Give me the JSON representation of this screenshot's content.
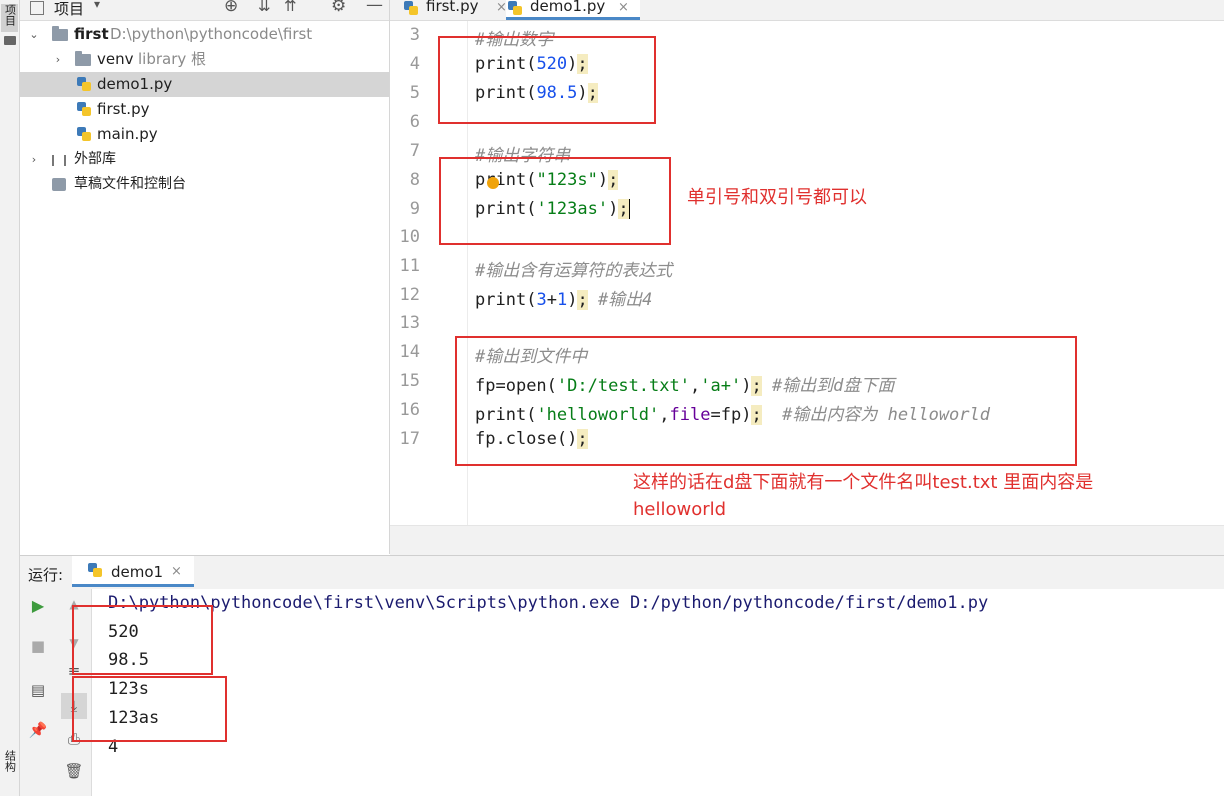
{
  "left_strip": {
    "project_label": "项目",
    "structure_label": "结构"
  },
  "project_panel": {
    "title": "项目",
    "tree": [
      {
        "name": "first",
        "path": "D:\\python\\pythoncode\\first"
      },
      {
        "name": "venv",
        "suffix": "library 根"
      },
      {
        "name": "demo1.py"
      },
      {
        "name": "first.py"
      },
      {
        "name": "main.py"
      },
      {
        "name": "外部库"
      },
      {
        "name": "草稿文件和控制台"
      }
    ]
  },
  "tabs": [
    {
      "label": "first.py",
      "close": "×"
    },
    {
      "label": "demo1.py",
      "close": "×"
    }
  ],
  "editor": {
    "line_numbers": [
      "3",
      "4",
      "5",
      "6",
      "7",
      "8",
      "9",
      "10",
      "11",
      "12",
      "13",
      "14",
      "15",
      "16",
      "17"
    ],
    "lines": {
      "l3": "#输出数字",
      "l4": {
        "fn": "print",
        "open": "(",
        "arg": "520",
        "close": ")",
        "semi": ";"
      },
      "l5": {
        "fn": "print",
        "open": "(",
        "arg": "98.5",
        "close": ")",
        "semi": ";"
      },
      "l7": "#输出字符串",
      "l8": {
        "fn": "print",
        "open": "(",
        "arg": "\"123s\"",
        "close": ")",
        "semi": ";"
      },
      "l9": {
        "fn": "print",
        "open": "(",
        "arg": "'123as'",
        "close": ")",
        "semi": ";"
      },
      "l11": "#输出含有运算符的表达式",
      "l12": {
        "fn": "print",
        "open": "(",
        "a": "3",
        "op": "+",
        "b": "1",
        "close": ")",
        "semi": ";",
        "comment": "#输出4"
      },
      "l14": "#输出到文件中",
      "l15": {
        "var": "fp=",
        "fn": "open",
        "open": "(",
        "s1": "'D:/test.txt'",
        "comma": ",",
        "s2": "'a+'",
        "close": ")",
        "semi": ";",
        "comment": "#输出到d盘下面"
      },
      "l16": {
        "fn": "print",
        "open": "(",
        "s1": "'helloworld'",
        "comma": ",",
        "param": "file",
        "eq": "=fp",
        "close": ")",
        "semi": ";",
        "comment": "#输出内容为 helloworld"
      },
      "l17": {
        "code": "fp.close()",
        "semi": ";"
      }
    }
  },
  "annotations": {
    "quote_note": "单引号和双引号都可以",
    "file_note_1": "这样的话在d盘下面就有一个文件名叫test.txt 里面内容是",
    "file_note_2": "helloworld"
  },
  "run_panel": {
    "label": "运行:",
    "tab": "demo1",
    "tab_close": "×",
    "output": [
      "D:\\python\\pythoncode\\first\\venv\\Scripts\\python.exe D:/python/pythoncode/first/demo1.py",
      "520",
      "98.5",
      "123s",
      "123as",
      "4"
    ]
  },
  "colors": {
    "annotation_red": "#e0302e",
    "current_line": "#fcf9e6",
    "selected_row": "#d5d5d5"
  }
}
